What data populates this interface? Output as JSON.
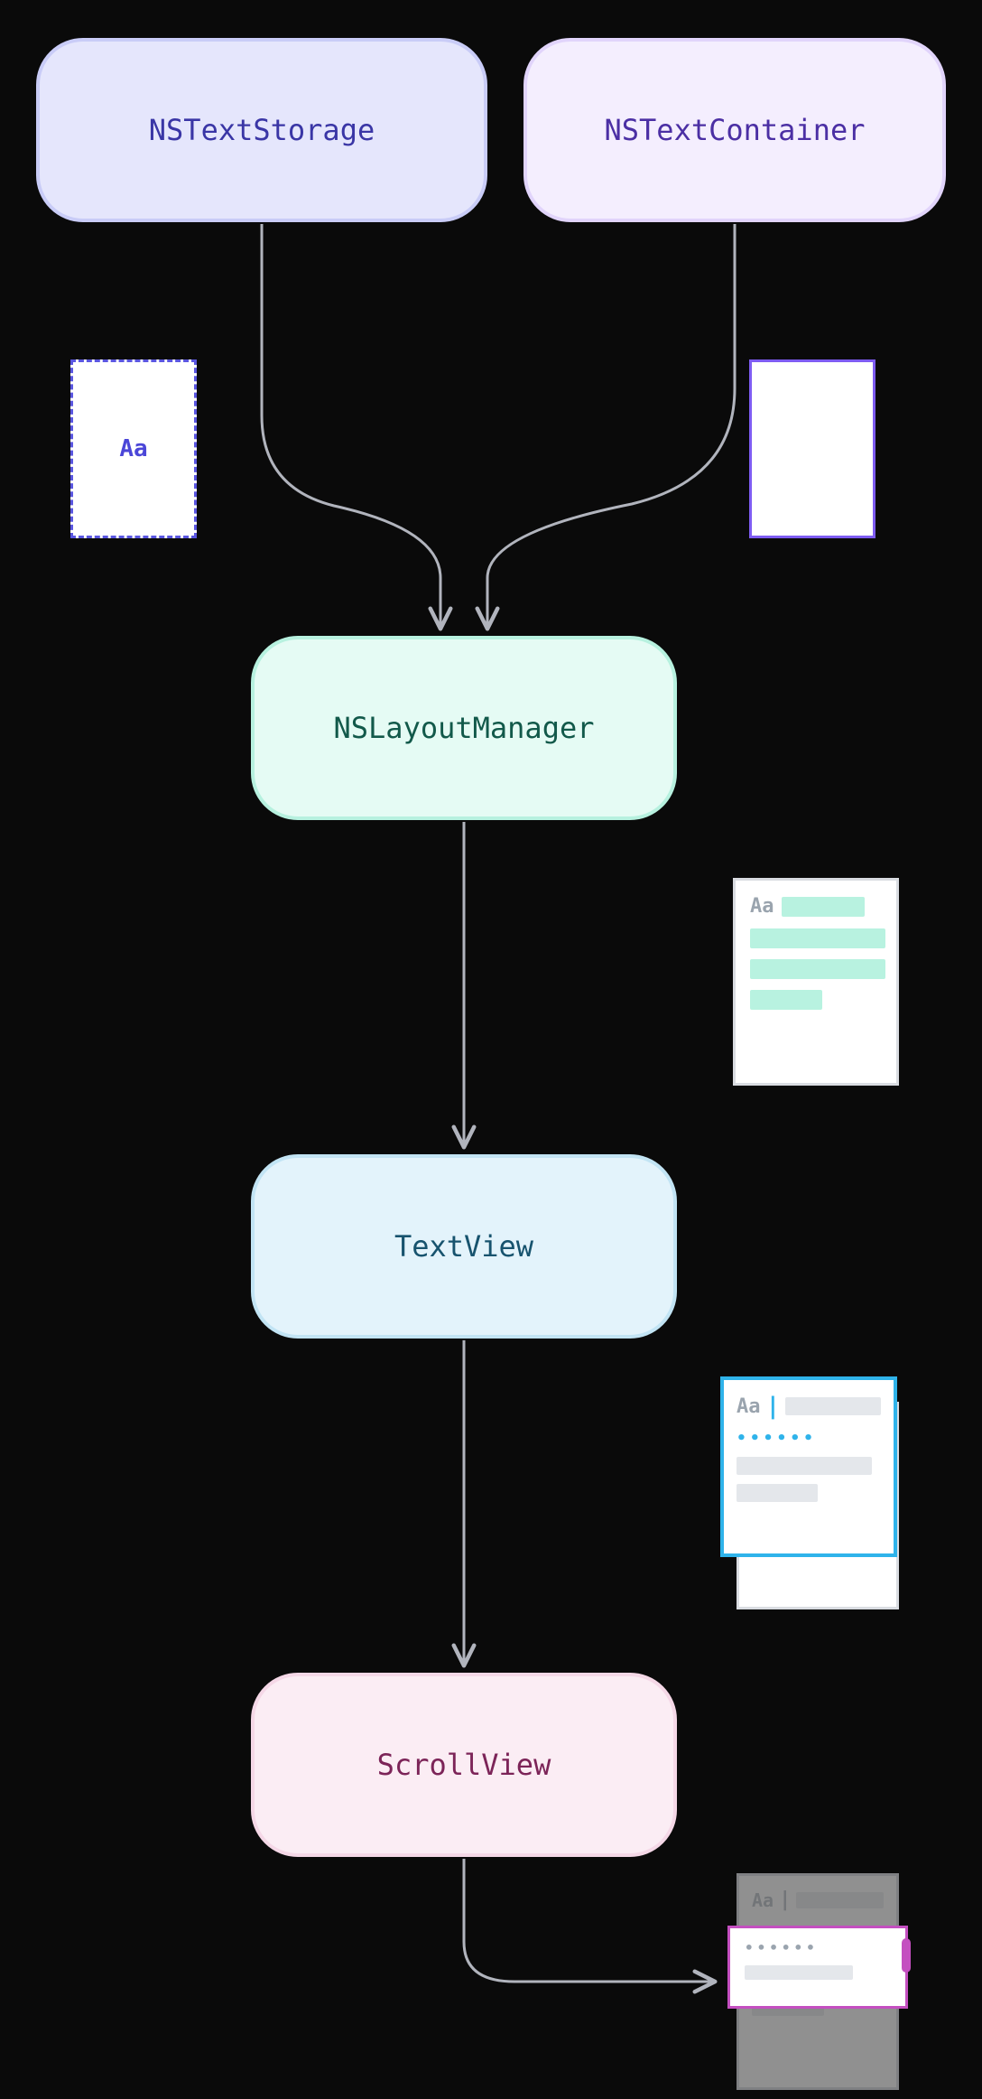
{
  "nodes": {
    "storage": {
      "label": "NSTextStorage"
    },
    "container": {
      "label": "NSTextContainer"
    },
    "layout": {
      "label": "NSLayoutManager"
    },
    "textview": {
      "label": "TextView"
    },
    "scrollview": {
      "label": "ScrollView"
    }
  },
  "glyph": {
    "aa": "Aa"
  },
  "arrows": [
    {
      "from": "storage",
      "to": "layout"
    },
    {
      "from": "container",
      "to": "layout"
    },
    {
      "from": "layout",
      "to": "textview"
    },
    {
      "from": "textview",
      "to": "scrollview"
    },
    {
      "from": "scrollview",
      "to": "scrollview-icon"
    }
  ]
}
